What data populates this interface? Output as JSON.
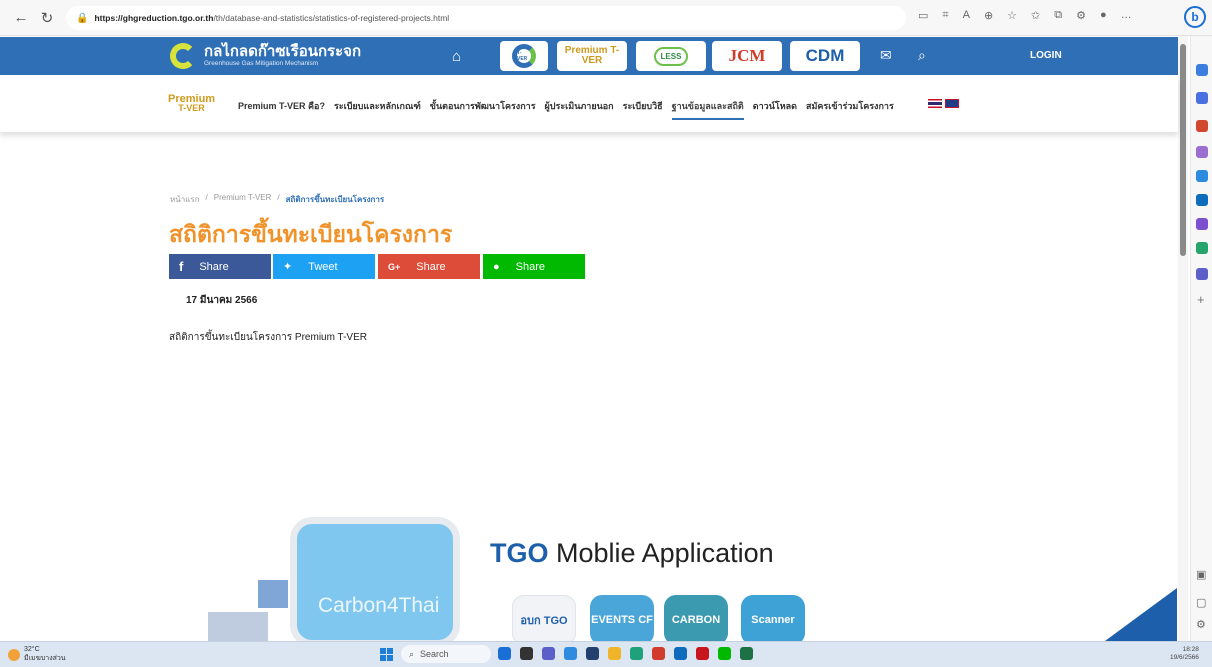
{
  "browser": {
    "url_host": "https://ghgreduction.tgo.or.th",
    "url_path": "/th/database-and-statistics/statistics-of-registered-projects.html",
    "bing_label": "b"
  },
  "site": {
    "logo_title": "กลไกลดก๊าซเรือนกระจก",
    "logo_subtitle": "Greenhouse Gas Mitigation Mechanism",
    "programs": [
      "T-VER",
      "Premium T-VER",
      "LESS",
      "JCM",
      "CDM"
    ],
    "login_label": "LOGIN"
  },
  "subnav": {
    "logo_line1": "Premium",
    "logo_line2": "T-VER",
    "items": [
      "Premium T-VER คือ?",
      "ระเบียบและหลักเกณฑ์",
      "ขั้นตอนการพัฒนาโครงการ",
      "ผู้ประเมินภายนอก",
      "ระเบียบวิธี",
      "ฐานข้อมูลและสถิติ",
      "ดาวน์โหลด",
      "สมัครเข้าร่วมโครงการ"
    ],
    "active_index": 5
  },
  "breadcrumb": [
    "หน้าแรก",
    "Premium T-VER",
    "สถิติการขึ้นทะเบียนโครงการ"
  ],
  "page": {
    "title": "สถิติการขึ้นทะเบียนโครงการ",
    "date": "17 มีนาคม 2566",
    "body": "สถิติการขึ้นทะเบียนโครงการ Premium T-VER"
  },
  "share": [
    {
      "icon": "f",
      "label": "Share",
      "color": "#3b5998"
    },
    {
      "icon": "✦",
      "label": "Tweet",
      "color": "#1da1f2"
    },
    {
      "icon": "G+",
      "label": "Share",
      "color": "#dd4b39"
    },
    {
      "icon": "●",
      "label": "Share",
      "color": "#00b900"
    }
  ],
  "app_section": {
    "title_bold": "TGO",
    "title_rest": "Moblie Application",
    "phone_text": "Carbon4Thai",
    "apps": [
      "อบก TGO",
      "EVENTS CF",
      "CARBON",
      "Scanner"
    ]
  },
  "taskbar": {
    "temperature": "32°C",
    "weather_text": "มีเมฆบางส่วน",
    "search_label": "Search",
    "time": "18:28",
    "date": "19/6/2566"
  },
  "colors": {
    "nav_blue": "#2f6fb6",
    "title_orange": "#f0932b"
  }
}
